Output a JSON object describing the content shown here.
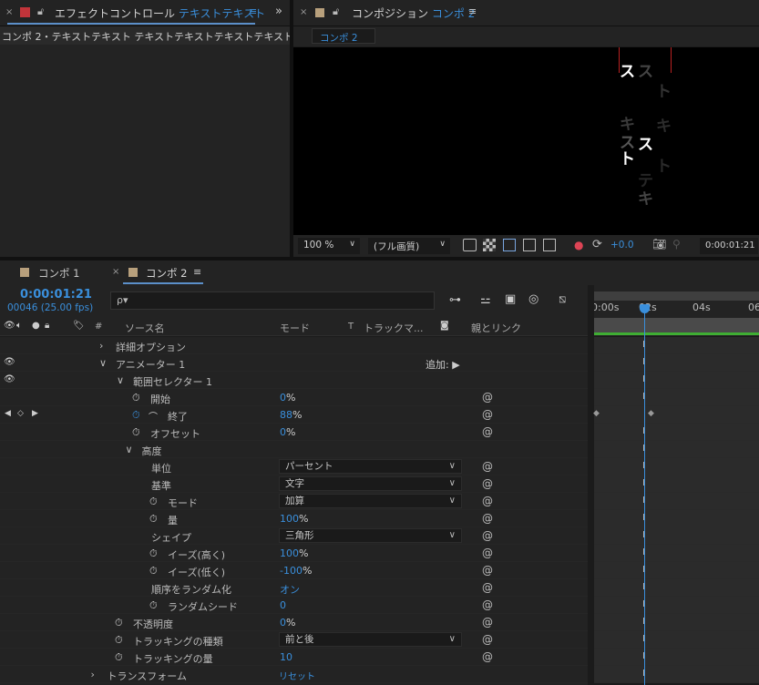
{
  "effects_panel": {
    "title_prefix": "エフェクトコントロール",
    "title_layer": "テキストテキスト",
    "subheader": "コンポ 2・テキストテキスト テキストテキストテキストテキスト テキス"
  },
  "comp_panel": {
    "title_prefix": "コンポジション",
    "title_comp": "コンポ 2",
    "tab": "コンポ 2",
    "zoom": "100 %",
    "quality": "(フル画質)",
    "exposure": "+0.0",
    "timecode": "0:00:01:21"
  },
  "viewer_text": {
    "white": [
      "ス",
      "ト",
      "ス",
      "ト",
      "キ"
    ],
    "dim": [
      "テ",
      "キ",
      "ス",
      "ト",
      "テ",
      "キ",
      "ス",
      "ト",
      "キ"
    ]
  },
  "timeline": {
    "tabs": [
      {
        "label": "コンポ 1"
      },
      {
        "label": "コンポ 2"
      }
    ],
    "timecode": "0:00:01:21",
    "frame_info": "00046 (25.00 fps)",
    "search_placeholder": "ρ▾",
    "columns": {
      "source": "ソース名",
      "mode": "モード",
      "t": "T",
      "track": "トラックマ...",
      "parent": "親とリンク",
      "hash": "#"
    },
    "ruler": [
      "0:00s",
      "02s",
      "04s",
      "06"
    ],
    "current_time_label": "02s",
    "add_label": "追加:",
    "reset_label": "リセット"
  },
  "properties": [
    {
      "label": "詳細オプション",
      "indent": 1,
      "twirl": "closed"
    },
    {
      "label": "アニメーター 1",
      "indent": 1,
      "twirl": "open",
      "add": true
    },
    {
      "label": "範囲セレクター 1",
      "indent": 2,
      "twirl": "open"
    },
    {
      "label": "開始",
      "indent": 3,
      "stopwatch": true,
      "value": "0",
      "unit": "%"
    },
    {
      "label": "終了",
      "indent": 3,
      "stopwatch": true,
      "graph": true,
      "value": "88",
      "unit": "%",
      "keyframes": true
    },
    {
      "label": "オフセット",
      "indent": 3,
      "stopwatch": true,
      "value": "0",
      "unit": "%"
    },
    {
      "label": "高度",
      "indent": 2.5,
      "twirl": "open"
    },
    {
      "label": "単位",
      "indent": 4,
      "dropdown": "パーセント"
    },
    {
      "label": "基準",
      "indent": 4,
      "dropdown": "文字"
    },
    {
      "label": "モード",
      "indent": 4,
      "stopwatch": true,
      "dropdown": "加算"
    },
    {
      "label": "量",
      "indent": 4,
      "stopwatch": true,
      "value": "100",
      "unit": "%"
    },
    {
      "label": "シェイプ",
      "indent": 4,
      "dropdown": "三角形"
    },
    {
      "label": "イーズ(高く)",
      "indent": 4,
      "stopwatch": true,
      "value": "100",
      "unit": "%"
    },
    {
      "label": "イーズ(低く)",
      "indent": 4,
      "stopwatch": true,
      "value": "-100",
      "unit": "%"
    },
    {
      "label": "順序をランダム化",
      "indent": 4,
      "value": "オン",
      "unit": ""
    },
    {
      "label": "ランダムシード",
      "indent": 4,
      "stopwatch": true,
      "value": "0",
      "unit": ""
    },
    {
      "label": "不透明度",
      "indent": 2,
      "stopwatch": true,
      "value": "0",
      "unit": "%"
    },
    {
      "label": "トラッキングの種類",
      "indent": 2,
      "stopwatch": true,
      "dropdown": "前と後"
    },
    {
      "label": "トラッキングの量",
      "indent": 2,
      "stopwatch": true,
      "value": "10",
      "unit": ""
    },
    {
      "label": "トランスフォーム",
      "indent": 0.5,
      "twirl": "closed",
      "reset": true
    }
  ]
}
